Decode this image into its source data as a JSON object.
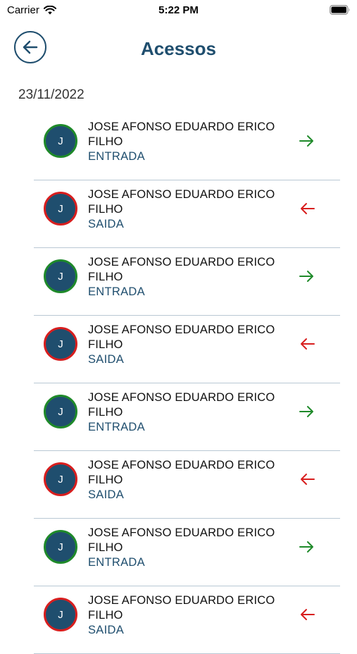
{
  "status_bar": {
    "carrier": "Carrier",
    "time": "5:22 PM"
  },
  "header": {
    "title": "Acessos"
  },
  "date": "23/11/2022",
  "colors": {
    "primary": "#1f4e6e",
    "entrada": "#1f8a2a",
    "saida": "#d81e1e"
  },
  "accesses": [
    {
      "initial": "J",
      "name": "JOSE AFONSO EDUARDO ERICO FILHO",
      "type": "ENTRADA",
      "direction": "in",
      "icon": "arrow-right-icon"
    },
    {
      "initial": "J",
      "name": "JOSE AFONSO EDUARDO ERICO FILHO",
      "type": "SAIDA",
      "direction": "out",
      "icon": "arrow-left-icon"
    },
    {
      "initial": "J",
      "name": "JOSE AFONSO EDUARDO ERICO FILHO",
      "type": "ENTRADA",
      "direction": "in",
      "icon": "arrow-right-icon"
    },
    {
      "initial": "J",
      "name": "JOSE AFONSO EDUARDO ERICO FILHO",
      "type": "SAIDA",
      "direction": "out",
      "icon": "arrow-left-icon"
    },
    {
      "initial": "J",
      "name": "JOSE AFONSO EDUARDO ERICO FILHO",
      "type": "ENTRADA",
      "direction": "in",
      "icon": "arrow-right-icon"
    },
    {
      "initial": "J",
      "name": "JOSE AFONSO EDUARDO ERICO FILHO",
      "type": "SAIDA",
      "direction": "out",
      "icon": "arrow-left-icon"
    },
    {
      "initial": "J",
      "name": "JOSE AFONSO EDUARDO ERICO FILHO",
      "type": "ENTRADA",
      "direction": "in",
      "icon": "arrow-right-icon"
    },
    {
      "initial": "J",
      "name": "JOSE AFONSO EDUARDO ERICO FILHO",
      "type": "SAIDA",
      "direction": "out",
      "icon": "arrow-left-icon"
    }
  ]
}
